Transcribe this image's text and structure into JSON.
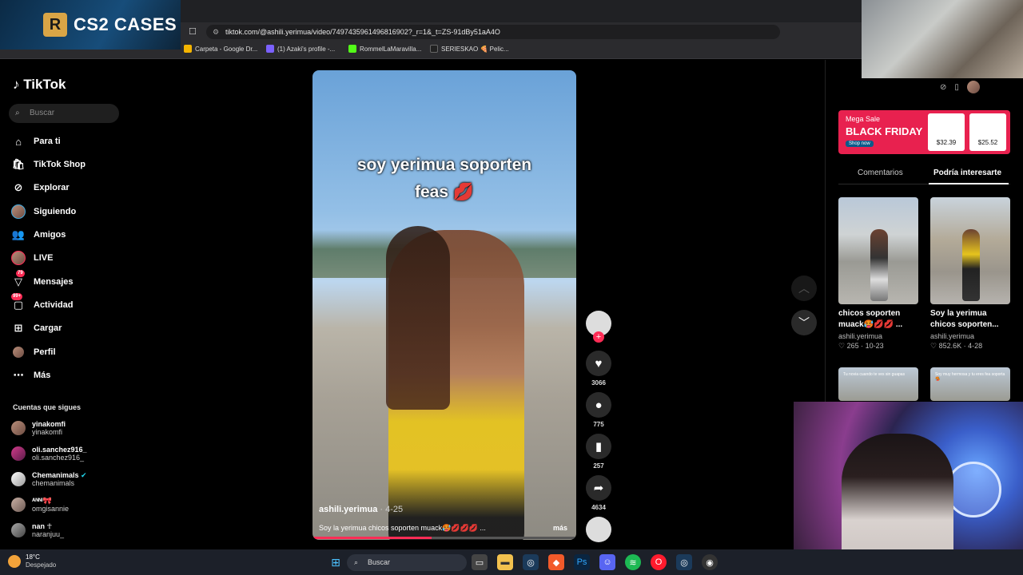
{
  "browser": {
    "url": "tiktok.com/@ashili.yerimua/video/7497435961496816902?_r=1&_t=ZS-91dBy51aA4O",
    "bookmarks": [
      "Carpeta - Google Dr...",
      "(1) Azaki's profile -...",
      "RommelLaMaravilla...",
      "SERIESKAO 🍕 Pelic..."
    ]
  },
  "overlay": {
    "cs2_logo": "R",
    "cs2_title": "CS2 CASES"
  },
  "sidebar": {
    "logo": "TikTok",
    "search_placeholder": "Buscar",
    "nav": [
      {
        "label": "Para ti",
        "icon": "home-icon"
      },
      {
        "label": "TikTok Shop",
        "icon": "shop-icon"
      },
      {
        "label": "Explorar",
        "icon": "compass-icon"
      },
      {
        "label": "Siguiendo",
        "icon": "following-avatar-icon"
      },
      {
        "label": "Amigos",
        "icon": "friends-icon"
      },
      {
        "label": "LIVE",
        "icon": "live-icon"
      },
      {
        "label": "Mensajes",
        "icon": "messages-icon",
        "badge": "79"
      },
      {
        "label": "Actividad",
        "icon": "activity-icon",
        "badge": "99+"
      },
      {
        "label": "Cargar",
        "icon": "upload-icon"
      },
      {
        "label": "Perfil",
        "icon": "profile-icon"
      },
      {
        "label": "Más",
        "icon": "more-icon"
      }
    ],
    "following_title": "Cuentas que sigues",
    "following": [
      {
        "name": "yinakomfi",
        "user": "yinakomfi"
      },
      {
        "name": "oli.sanchez916_",
        "user": "oli.sanchez916_"
      },
      {
        "name": "Chemanimals",
        "user": "chemanimals"
      },
      {
        "name": "ᴬᴺᴺᴵ🎀",
        "user": "omgisannie"
      },
      {
        "name": "nan ☥",
        "user": "naranjuu_"
      }
    ]
  },
  "video": {
    "caption_line1": "soy yerimua soporten",
    "caption_line2": "feas 💋",
    "author": "ashili.yerimua",
    "date": " · 4-25",
    "description": "Soy la yerimua chicos soporten muack🥵💋💋💋 ...",
    "more": "más",
    "progress": 0.45
  },
  "actions": {
    "likes": "3066",
    "comments": "775",
    "saves": "257",
    "shares": "4634"
  },
  "right_panel": {
    "ad": {
      "line1": "Mega Sale",
      "line2": "BLACK FRIDAY",
      "shop": "Shop now",
      "price1": "$32.39",
      "price2": "$25.52"
    },
    "tabs": [
      "Comentarios",
      "Podría interesarte"
    ],
    "active_tab": "Podría interesarte",
    "cards": [
      {
        "title": "chicos soporten muack🥵💋💋 ...",
        "user": "ashili.yerimua",
        "stats": "♡ 265 · 10-23"
      },
      {
        "title": "Soy la yerimua chicos soporten...",
        "user": "ashili.yerimua",
        "stats": "♡ 852.6K · 4-28"
      }
    ],
    "card_overlays": [
      "Tu novia cuando te ves sin guapas",
      "Soy muy hermosa y tu eres fea soporta 🥵"
    ]
  },
  "taskbar": {
    "temp": "18°C",
    "weather": "Despejado",
    "search": "Buscar"
  },
  "colors": {
    "accent": "#fe2c55",
    "background": "#000000"
  }
}
